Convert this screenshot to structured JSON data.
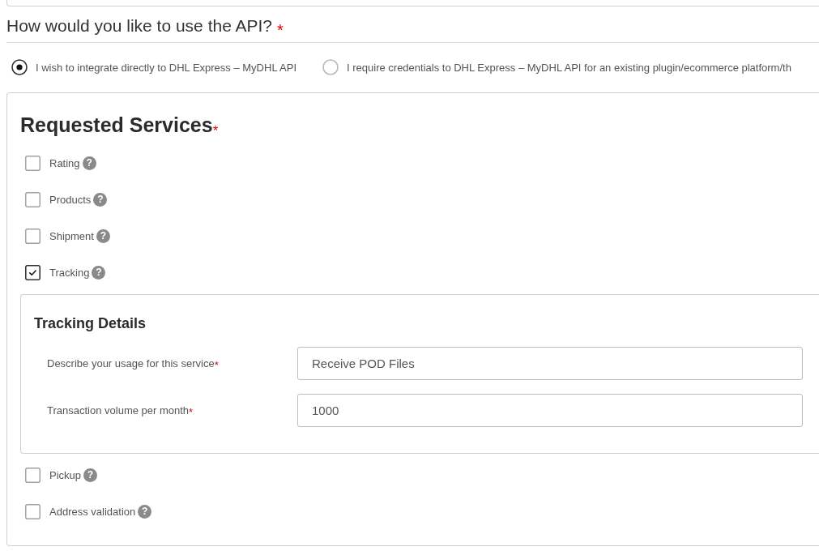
{
  "question": {
    "title": "How would you like to use the API?",
    "required_mark": "*"
  },
  "usage_options": [
    {
      "label": "I wish to integrate directly to DHL Express – MyDHL API",
      "selected": true
    },
    {
      "label": "I require credentials to DHL Express – MyDHL API for an existing plugin/ecommerce platform/th",
      "selected": false
    }
  ],
  "requested_services": {
    "title": "Requested Services",
    "required_mark": "*",
    "services": [
      {
        "label": "Rating",
        "checked": false,
        "help": "?"
      },
      {
        "label": "Products",
        "checked": false,
        "help": "?"
      },
      {
        "label": "Shipment",
        "checked": false,
        "help": "?"
      },
      {
        "label": "Tracking",
        "checked": true,
        "help": "?",
        "details": {
          "title": "Tracking Details",
          "fields": [
            {
              "label": "Describe your usage for this service",
              "required_mark": "*",
              "value": "Receive POD Files"
            },
            {
              "label": "Transaction volume per month",
              "required_mark": "*",
              "value": "1000"
            }
          ]
        }
      },
      {
        "label": "Pickup",
        "checked": false,
        "help": "?"
      },
      {
        "label": "Address validation",
        "checked": false,
        "help": "?"
      }
    ]
  }
}
